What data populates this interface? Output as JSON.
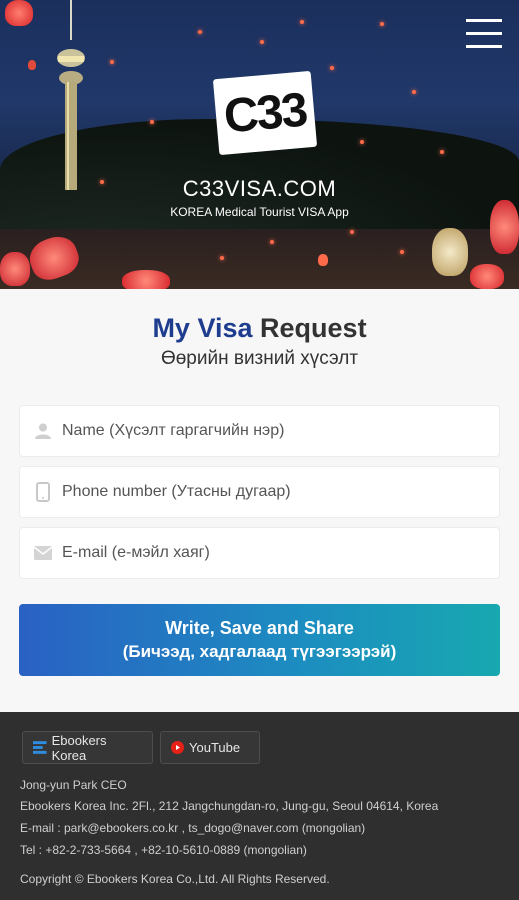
{
  "header": {
    "logo_text": "C33",
    "site_title": "C33VISA.COM",
    "site_subtitle": "KOREA Medical Tourist VISA App",
    "menu_icon": "hamburger-menu-icon"
  },
  "request": {
    "title_part1": "My Visa",
    "title_part2": "Request",
    "subtitle": "Өөрийн визний хүсэлт"
  },
  "form": {
    "name_placeholder": "Name (Хүсэлт гаргагчийн нэр)",
    "phone_placeholder": "Phone number (Утасны дугаар)",
    "email_placeholder": "E-mail (е-мэйл хаяг)",
    "submit_line1": "Write, Save and Share",
    "submit_line2": "(Бичээд, хадгалаад түгээгээрэй)"
  },
  "footer": {
    "ebookers_label": "Ebookers Korea",
    "youtube_label": "YouTube",
    "ceo": "Jong-yun Park  CEO",
    "address": "Ebookers Korea Inc. 2Fl., 212 Jangchungdan-ro, Jung-gu, Seoul 04614, Korea",
    "email": "E-mail : park@ebookers.co.kr  ,  ts_dogo@naver.com (mongolian)",
    "tel": "Tel : +82-2-733-5664  ,  +82-10-5610-0889 (mongolian)",
    "copyright": "Copyright © Ebookers Korea Co.,Ltd.  All Rights Reserved."
  },
  "colors": {
    "brand_blue": "#1f3d8f",
    "cta_start": "#2a61c4",
    "cta_end": "#18a8b0",
    "footer_bg": "#2f2f2f",
    "youtube_red": "#e62117"
  }
}
